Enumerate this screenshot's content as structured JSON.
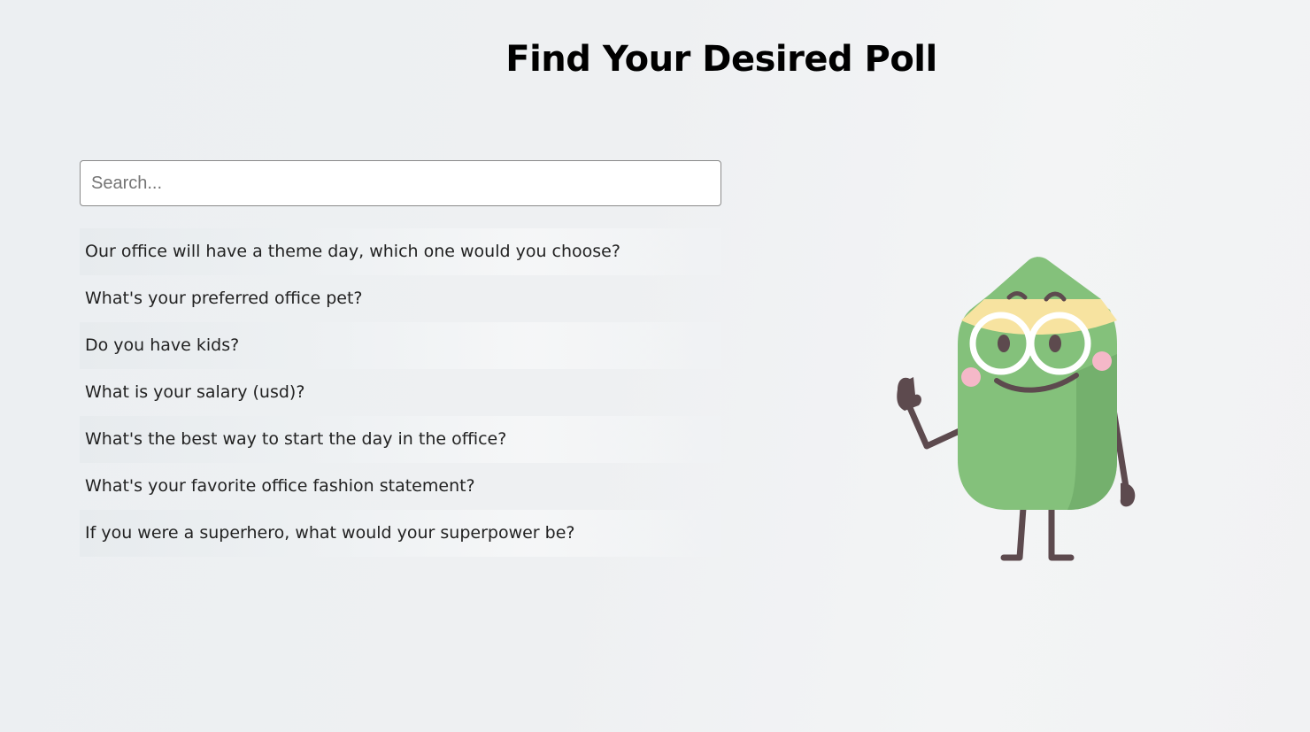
{
  "header": {
    "title": "Find Your Desired Poll"
  },
  "search": {
    "placeholder": "Search...",
    "value": ""
  },
  "polls": [
    "Our office will have a theme day, which one would you choose?",
    "What's your preferred office pet?",
    "Do you have kids?",
    "What is your salary (usd)?",
    "What's the best way to start the day in the office?",
    "What's your favorite office fashion statement?",
    "If you were a superhero, what would your superpower be?"
  ],
  "illustration": {
    "icon": "pencil-mascot-icon",
    "colors": {
      "body": "#84c17b",
      "body_shade": "#74b06d",
      "tip": "#f7e3a0",
      "limbs": "#5d4a4e",
      "cheeks": "#f5b8c8",
      "glasses": "#ffffff"
    }
  }
}
